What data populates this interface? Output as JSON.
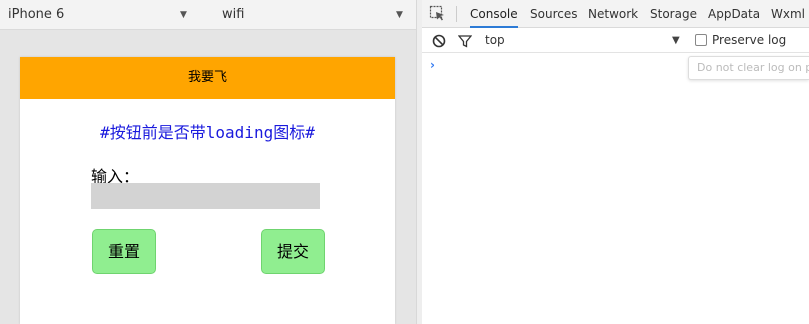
{
  "simulator": {
    "device": "iPhone 6",
    "network": "wifi",
    "caret_icon": "chevron-down-icon"
  },
  "page": {
    "nav_title": "我要飞",
    "nav_color": "#ffa500",
    "heading": "#按钮前是否带loading图标#",
    "heading_color": "#1a1add",
    "input_label": "输入：",
    "input_value": "",
    "reset_label": "重置",
    "submit_label": "提交",
    "button_color": "#90ee90"
  },
  "devtools": {
    "tabs": [
      "Console",
      "Sources",
      "Network",
      "Storage",
      "AppData",
      "Wxml"
    ],
    "active_tab": "Console",
    "context": "top",
    "preserve_log_label": "Preserve log",
    "preserve_log_checked": false,
    "tooltip": "Do not clear log on page",
    "prompt_symbol": "›"
  }
}
